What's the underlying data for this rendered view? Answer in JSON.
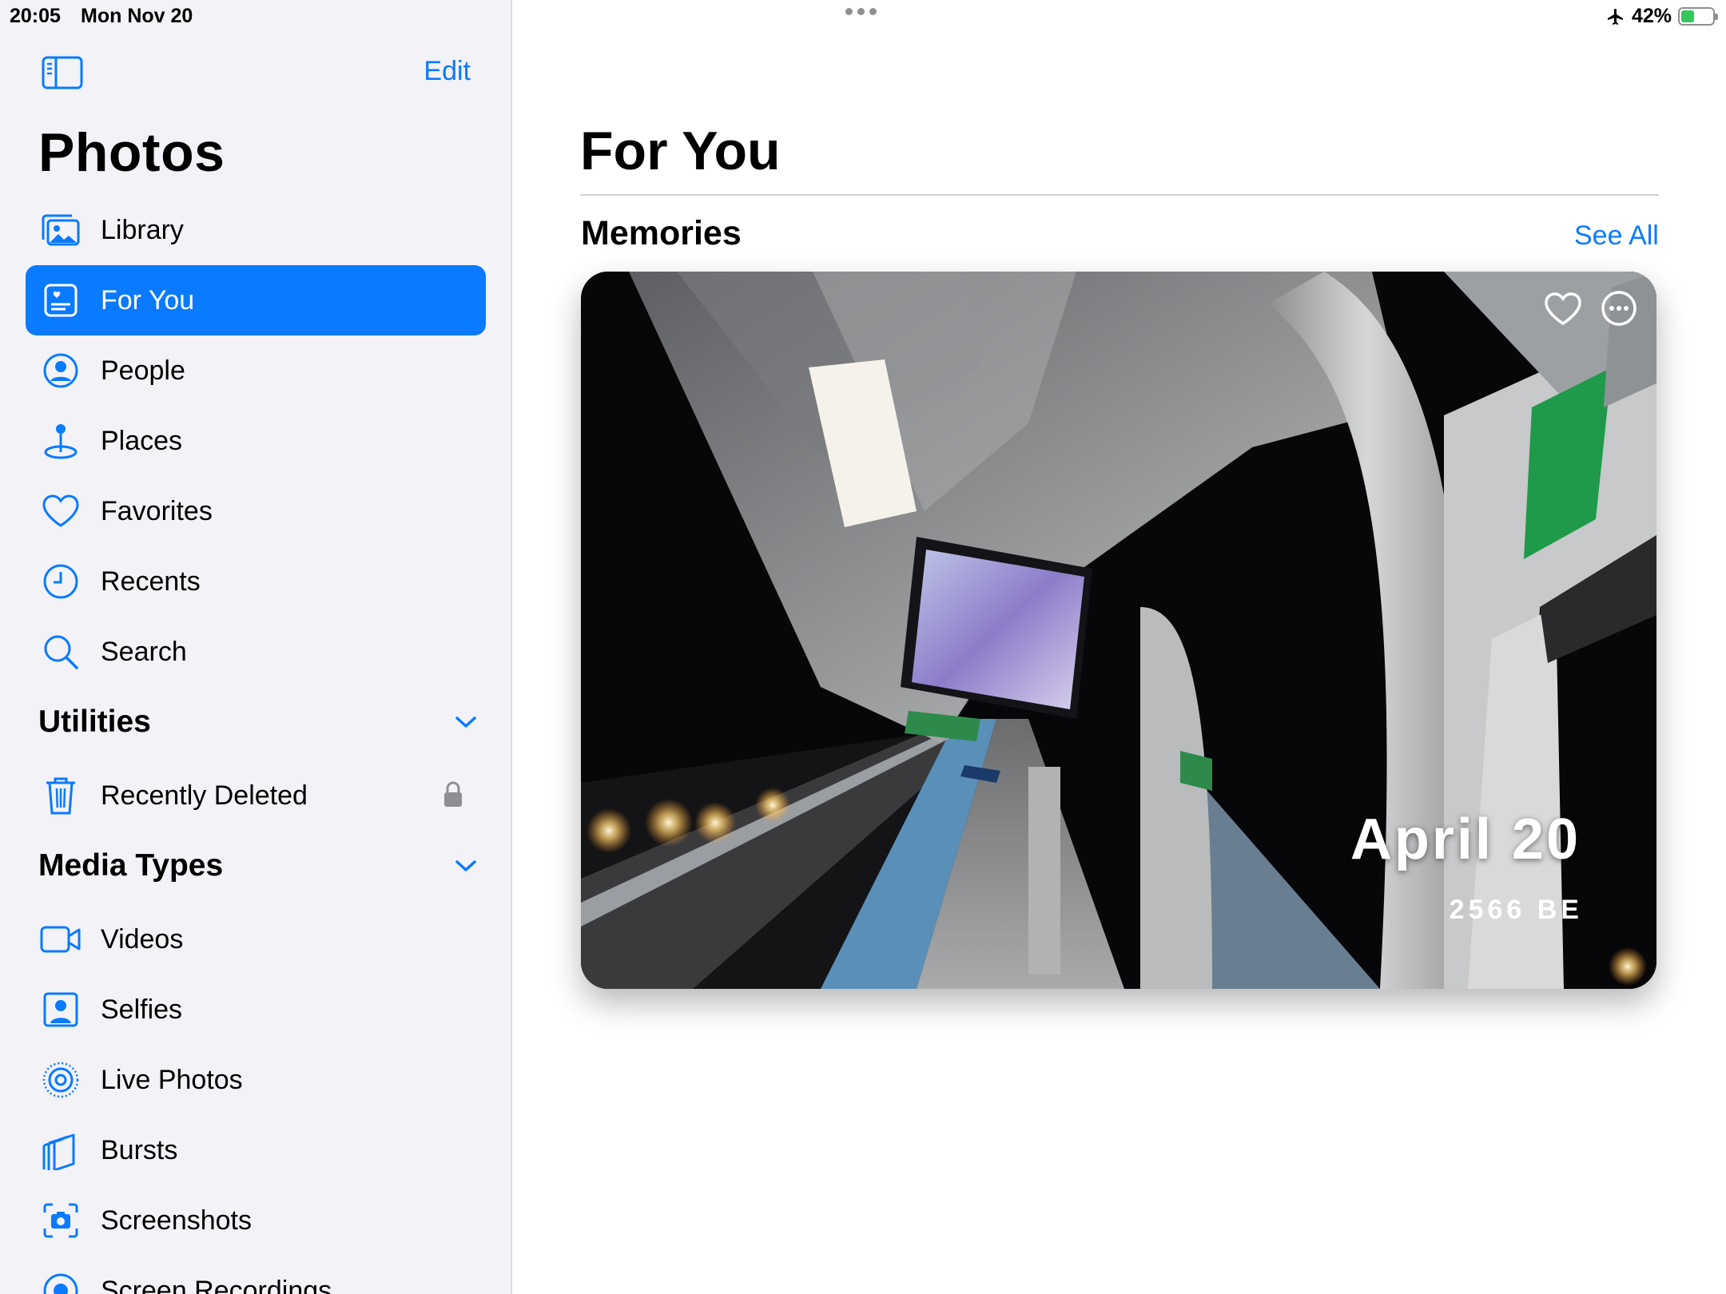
{
  "status_bar": {
    "time": "20:05",
    "date": "Mon Nov 20",
    "battery": "42%",
    "battery_level": 0.42
  },
  "sidebar": {
    "edit_label": "Edit",
    "title": "Photos",
    "items": [
      {
        "label": "Library",
        "icon": "library-icon",
        "selected": false
      },
      {
        "label": "For You",
        "icon": "for-you-icon",
        "selected": true
      },
      {
        "label": "People",
        "icon": "person-circle-icon",
        "selected": false
      },
      {
        "label": "Places",
        "icon": "map-pin-icon",
        "selected": false
      },
      {
        "label": "Favorites",
        "icon": "heart-icon",
        "selected": false
      },
      {
        "label": "Recents",
        "icon": "clock-icon",
        "selected": false
      },
      {
        "label": "Search",
        "icon": "search-icon",
        "selected": false
      }
    ],
    "utilities": {
      "label": "Utilities",
      "items": [
        {
          "label": "Recently Deleted",
          "icon": "trash-icon",
          "locked": true
        }
      ]
    },
    "media_types": {
      "label": "Media Types",
      "items": [
        {
          "label": "Videos",
          "icon": "video-icon"
        },
        {
          "label": "Selfies",
          "icon": "selfie-icon"
        },
        {
          "label": "Live Photos",
          "icon": "live-photo-icon"
        },
        {
          "label": "Bursts",
          "icon": "bursts-icon"
        },
        {
          "label": "Screenshots",
          "icon": "screenshot-icon"
        },
        {
          "label": "Screen Recordings",
          "icon": "screen-recording-icon"
        }
      ]
    }
  },
  "main": {
    "title": "For You",
    "memories": {
      "label": "Memories",
      "see_all": "See All",
      "card": {
        "title": "April 20",
        "subtitle": "2566 BE"
      }
    }
  },
  "colors": {
    "accent": "#0a7aff",
    "sidebar_bg": "#f2f2f7",
    "battery": "#34c759"
  }
}
